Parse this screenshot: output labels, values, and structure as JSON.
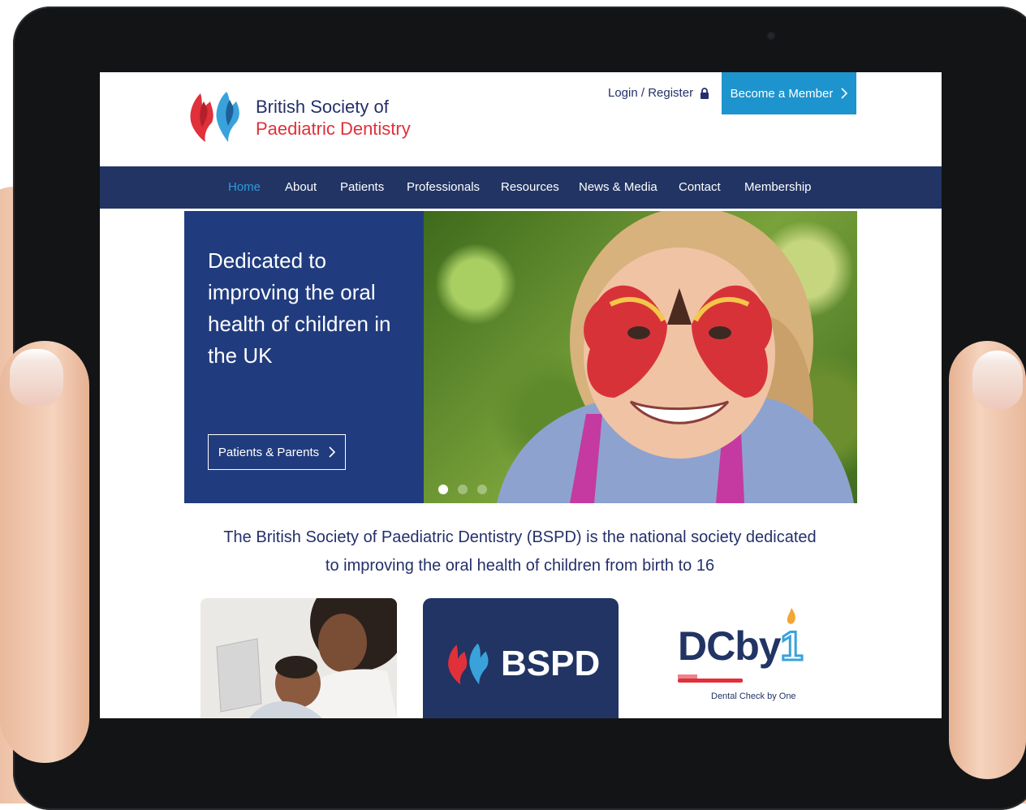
{
  "header": {
    "brand_line1": "British Society of",
    "brand_line2": "Paediatric Dentistry",
    "login_label": "Login / Register",
    "member_button_label": "Become a Member"
  },
  "nav": {
    "items": [
      {
        "label": "Home",
        "active": true
      },
      {
        "label": "About"
      },
      {
        "label": "Patients"
      },
      {
        "label": "Professionals"
      },
      {
        "label": "Resources"
      },
      {
        "label": "News & Media"
      },
      {
        "label": "Contact"
      },
      {
        "label": "Membership"
      }
    ]
  },
  "hero": {
    "headline": "Dedicated to improving the oral health of children in the UK",
    "button_label": "Patients & Parents",
    "slide_count": 3,
    "active_slide": 1
  },
  "intro": {
    "text": "The British Society of Paediatric Dentistry (BSPD) is the national society dedicated to improving the oral health of children from birth to 16"
  },
  "cards": {
    "bspd_label": "BSPD",
    "dcby1_label": "DCby",
    "dcby1_number": "1",
    "dcby1_sub": "Dental Check by One"
  },
  "colors": {
    "navy": "#213464",
    "hero_blue": "#213c7e",
    "accent_blue": "#1d94cd",
    "brand_red": "#e0303a"
  }
}
